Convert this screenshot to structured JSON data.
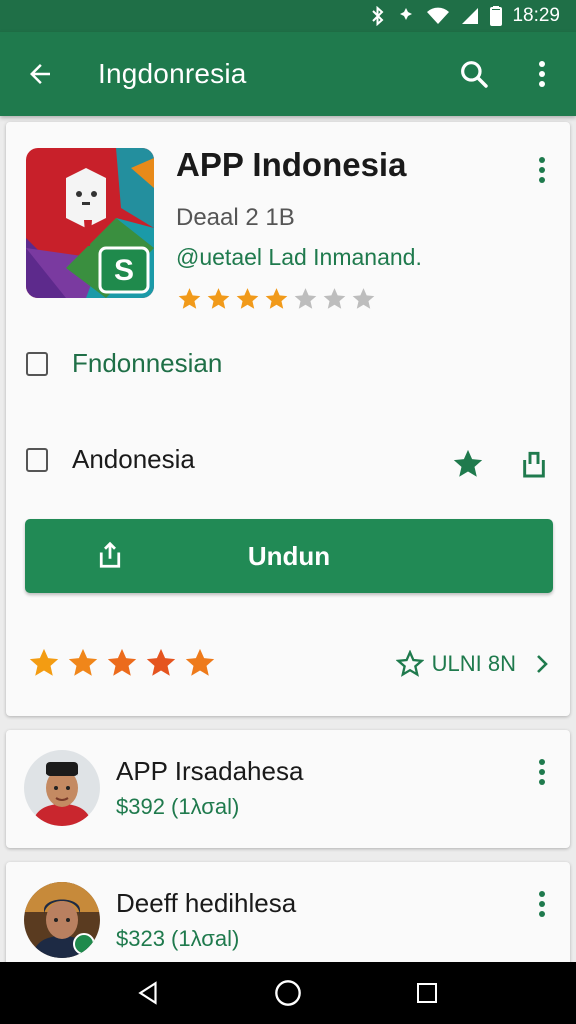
{
  "status": {
    "time": "18:29"
  },
  "appbar": {
    "title": "Ingdonresia"
  },
  "app": {
    "title": "APP Indonesia",
    "subtitle": "Deaal 2 1Β",
    "developer": "@uetael Lad Inmanand.",
    "rating": 4,
    "rating_max": 7
  },
  "options": [
    {
      "label": "Fndonnesian"
    },
    {
      "label": "Andonesia"
    }
  ],
  "install": {
    "label": "Undun"
  },
  "bottom_rating": {
    "stars": 5,
    "link_label": "ULNI 8N"
  },
  "reviews": [
    {
      "name": "APP Irsadahesa",
      "meta": "$392 (1λσal)"
    },
    {
      "name": "Deeff hedihlesa",
      "meta": "$323 (1λσal)"
    }
  ],
  "colors": {
    "primary": "#1f7a4d",
    "status_bar": "#1f6f47",
    "star": "#f19a1a",
    "star_empty": "#bdbdbd"
  }
}
